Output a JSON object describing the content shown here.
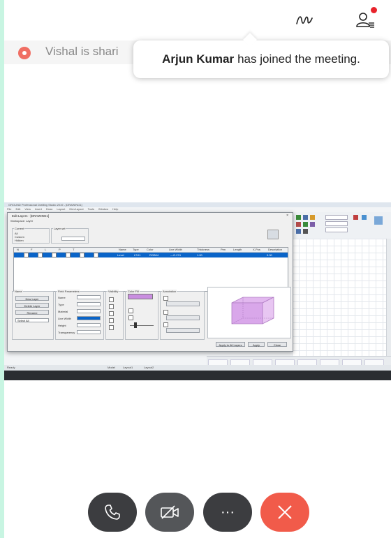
{
  "header": {
    "annotate_icon": "annotate-squiggle-icon",
    "participants_icon": "participants-icon",
    "notification_dot_color": "#e8232b"
  },
  "share_banner": {
    "text": "Vishal is shari",
    "record_icon": "recording-icon",
    "record_color": "#f06e63"
  },
  "toast": {
    "name": "Arjun Kumar",
    "message": "has joined the meeting."
  },
  "shared_screen": {
    "window_title": "GROUND Professional Drafting Studio 2019 - [DRAWING1]",
    "menu": [
      "File",
      "Edit",
      "View",
      "Insert",
      "Draw",
      "Layout",
      "Dim/Layout",
      "Tools",
      "Window",
      "Help"
    ],
    "dialog": {
      "title": "Edit Layers - [DRAWING1]",
      "subtitle": "Workspace: Layer",
      "close": "×",
      "table_headers": [
        "N",
        "F",
        "L",
        "P",
        "T",
        "Name",
        "Type",
        "Color",
        "Line Width",
        "Thickness",
        "Pen",
        "Length",
        "X-Pos",
        "Description"
      ],
      "row": [
        "Level",
        "LT:01",
        "RGB04",
        "—G.274",
        "1.00",
        "0.00"
      ],
      "labels": {
        "current": "Current",
        "layer_set": "Layer set",
        "field_params": "Field Parameters",
        "visibility": "Visibility",
        "color_group": "Color Fill",
        "annotations": "Annotation",
        "apply": "Apply",
        "ok": "OK",
        "cancel": "Close",
        "apply_to_all": "Apply to All Layers",
        "layer_name": "Name",
        "type_label": "Type",
        "material": "Material",
        "line_width": "Line Width",
        "height": "Height",
        "transparency": "Transparency",
        "new_layer": "New Layer",
        "delete_layer": "Delete Layer",
        "rename": "Rename",
        "select_all": "Select All",
        "option_all": "All",
        "option_custom": "Custom",
        "option_hidden": "Hidden"
      },
      "fill_color": "#c98ee0"
    },
    "status": {
      "left": "Ready",
      "tabs": [
        "Model",
        "Layout1",
        "Layout2"
      ]
    }
  },
  "controls": {
    "phone": {
      "icon": "phone-icon",
      "color": "#3c3d40"
    },
    "video": {
      "icon": "video-off-icon",
      "color": "#545659"
    },
    "more": {
      "icon": "more-options-icon",
      "label": "···",
      "color": "#3c3d40"
    },
    "leave": {
      "icon": "leave-close-icon",
      "color": "#f15b4a"
    }
  }
}
